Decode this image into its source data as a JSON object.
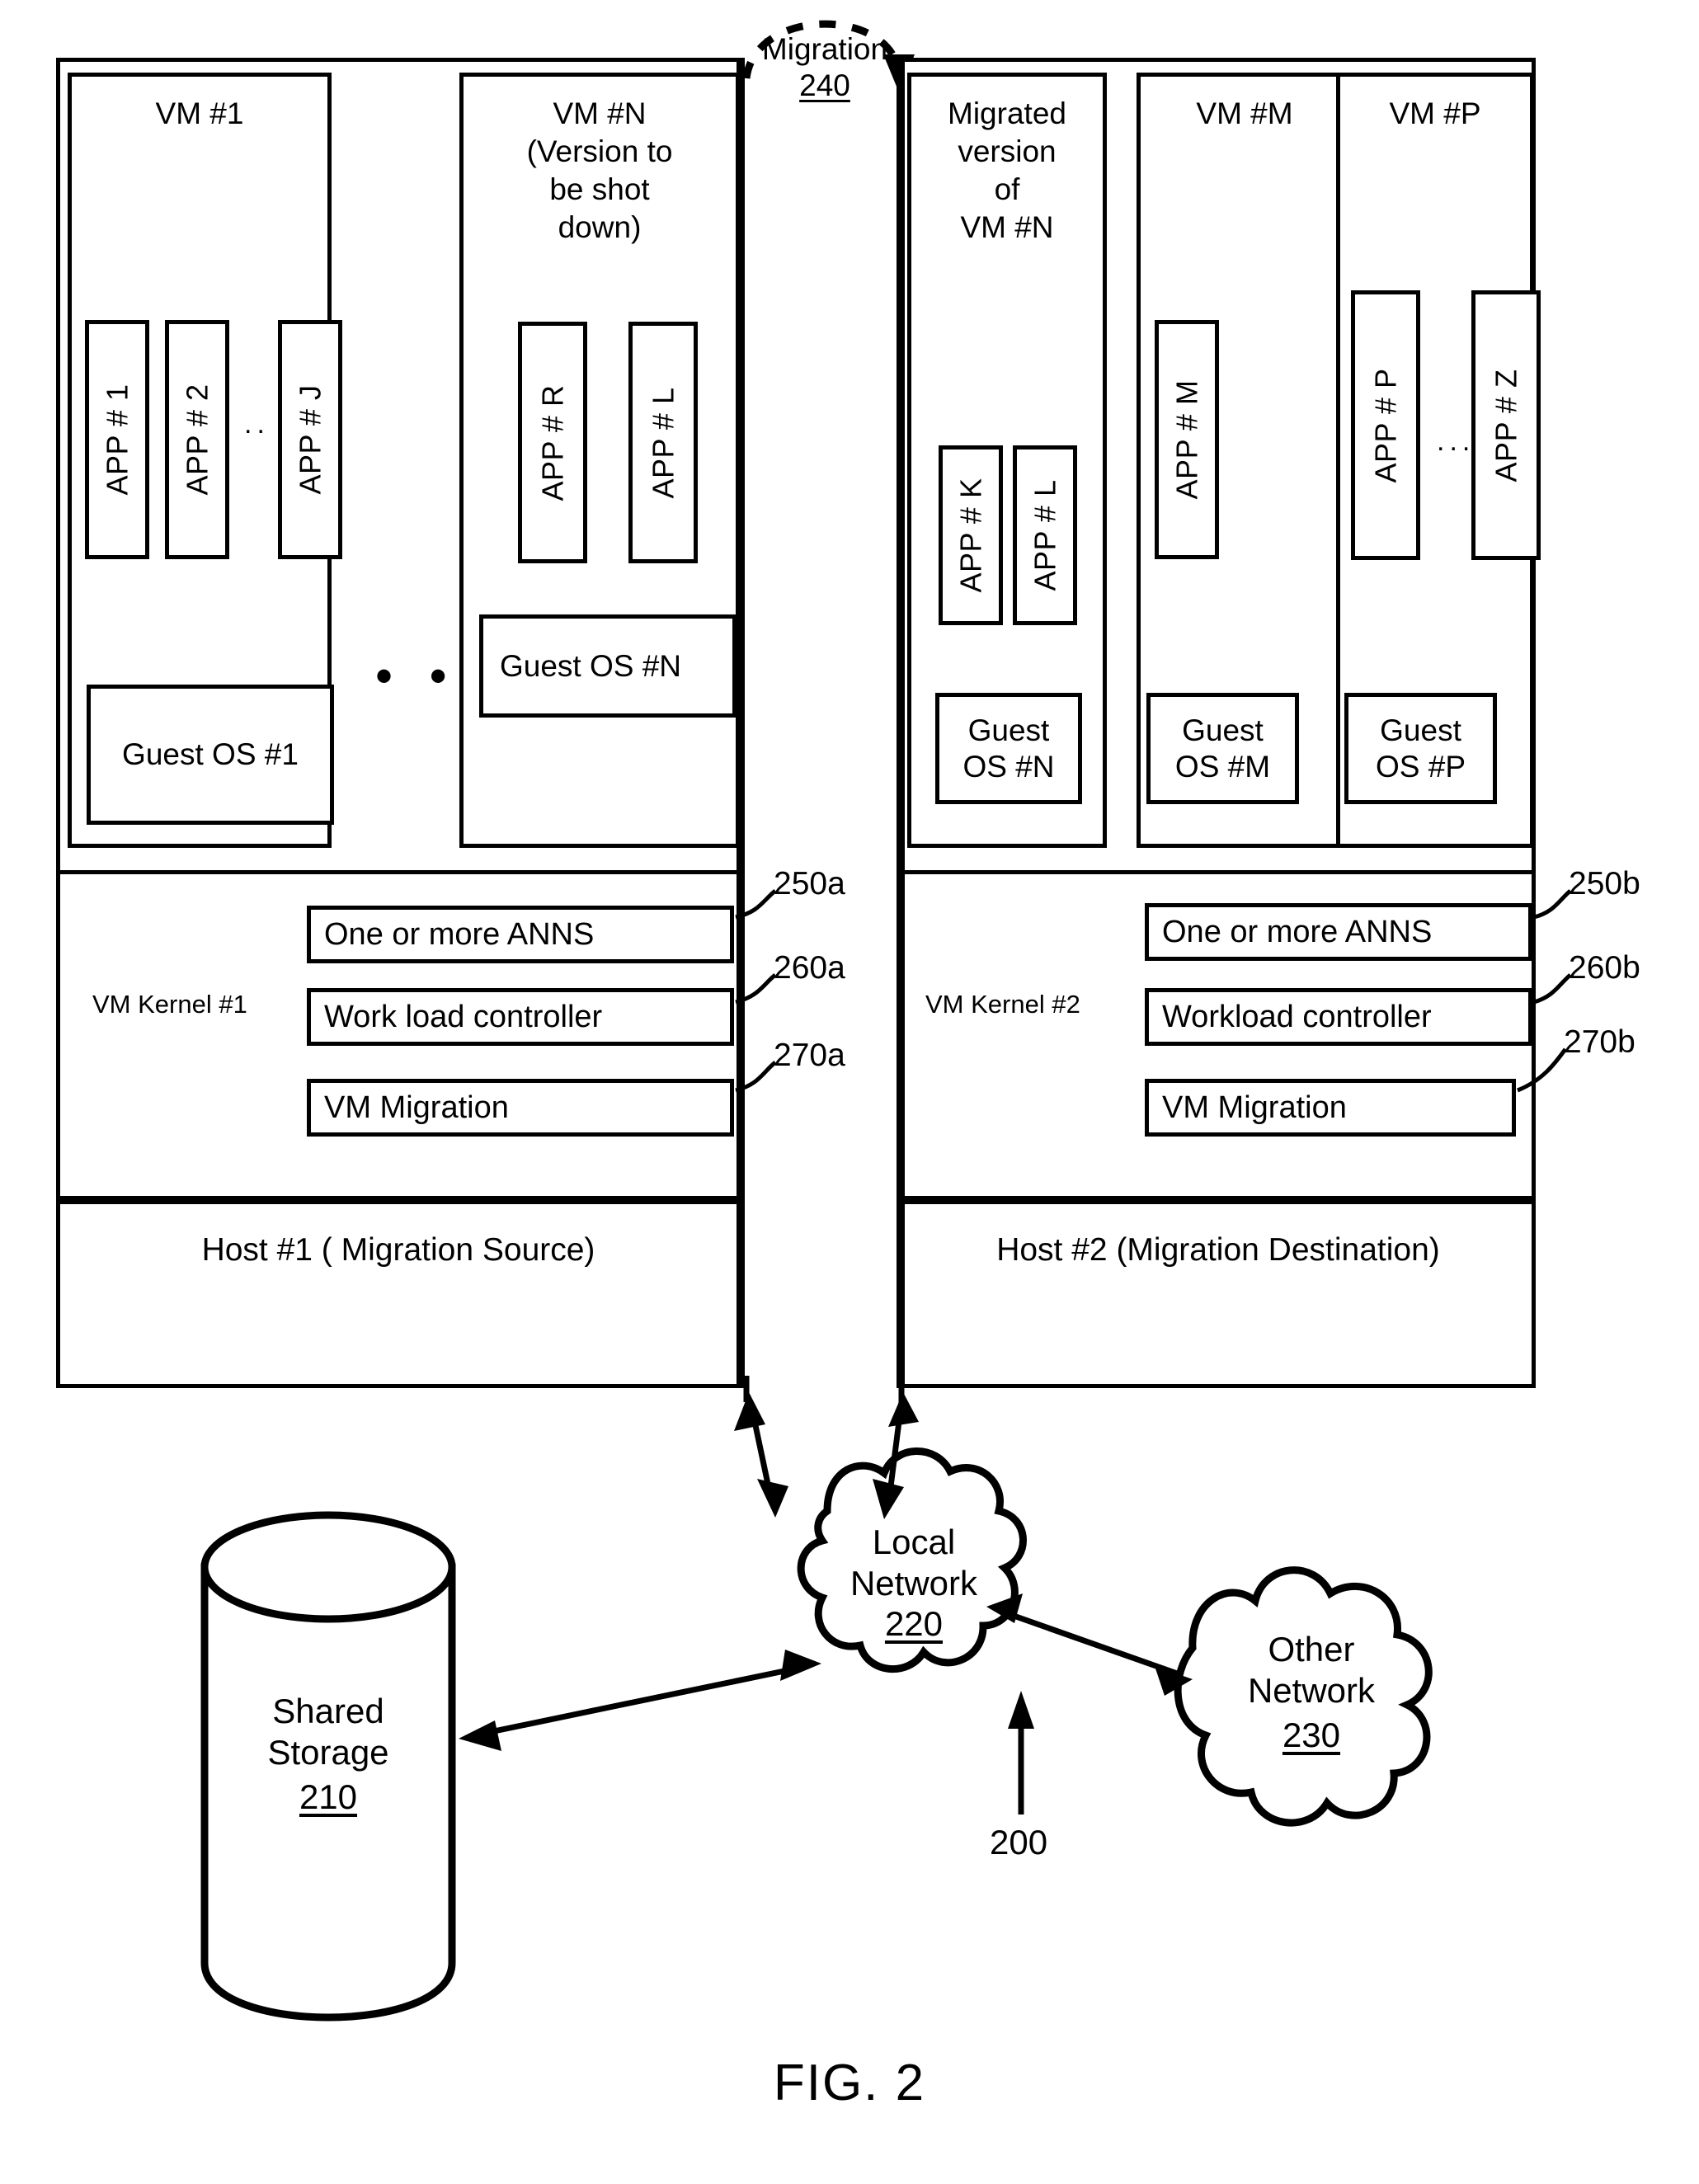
{
  "figure": {
    "caption": "FIG. 2",
    "system_ref": "200"
  },
  "migration": {
    "label": "Migration",
    "ref": "240"
  },
  "hosts": [
    {
      "id": "host1",
      "footer_label": "Host #1 ( Migration Source)",
      "kernel_name": "VM Kernel #1",
      "kernel_modules": [
        {
          "label": "One or more ANNS",
          "ref": "250a"
        },
        {
          "label": "Work load controller",
          "ref": "260a"
        },
        {
          "label": "VM Migration",
          "ref": "270a"
        }
      ],
      "vms": [
        {
          "title": "VM #1",
          "apps": [
            "APP # 1",
            "APP # 2",
            "APP # J"
          ],
          "app_ellipsis": "..",
          "guest_os": "Guest OS #1"
        },
        {
          "title": "VM #N\n(Version to\nbe shot\ndown)",
          "apps": [
            "APP # R",
            "APP # L"
          ],
          "app_ellipsis": "",
          "guest_os": "Guest OS #N"
        }
      ],
      "vm_ellipsis": "• • •"
    },
    {
      "id": "host2",
      "footer_label": "Host #2 (Migration Destination)",
      "kernel_name": "VM Kernel #2",
      "kernel_modules": [
        {
          "label": "One or more ANNS",
          "ref": "250b"
        },
        {
          "label": "Workload controller",
          "ref": "260b"
        },
        {
          "label": "VM Migration",
          "ref": "270b"
        }
      ],
      "vms": [
        {
          "title": "Migrated\nversion\nof\nVM #N",
          "apps": [
            "APP # K",
            "APP # L"
          ],
          "app_ellipsis": "",
          "guest_os": "Guest\nOS #N"
        },
        {
          "title": "VM #M",
          "apps": [
            "APP # M"
          ],
          "app_ellipsis": "",
          "guest_os": "Guest\nOS #M"
        },
        {
          "title": "VM #P",
          "apps": [
            "APP # P",
            "APP # Z"
          ],
          "app_ellipsis": "...",
          "guest_os": "Guest\nOS #P"
        }
      ],
      "vm_ellipsis": ""
    }
  ],
  "nodes": {
    "shared_storage": {
      "label": "Shared\nStorage",
      "ref": "210"
    },
    "local_network": {
      "label": "Local\nNetwork",
      "ref": "220"
    },
    "other_network": {
      "label": "Other\nNetwork",
      "ref": "230"
    }
  },
  "colors": {
    "stroke": "#000000",
    "background": "#ffffff"
  }
}
